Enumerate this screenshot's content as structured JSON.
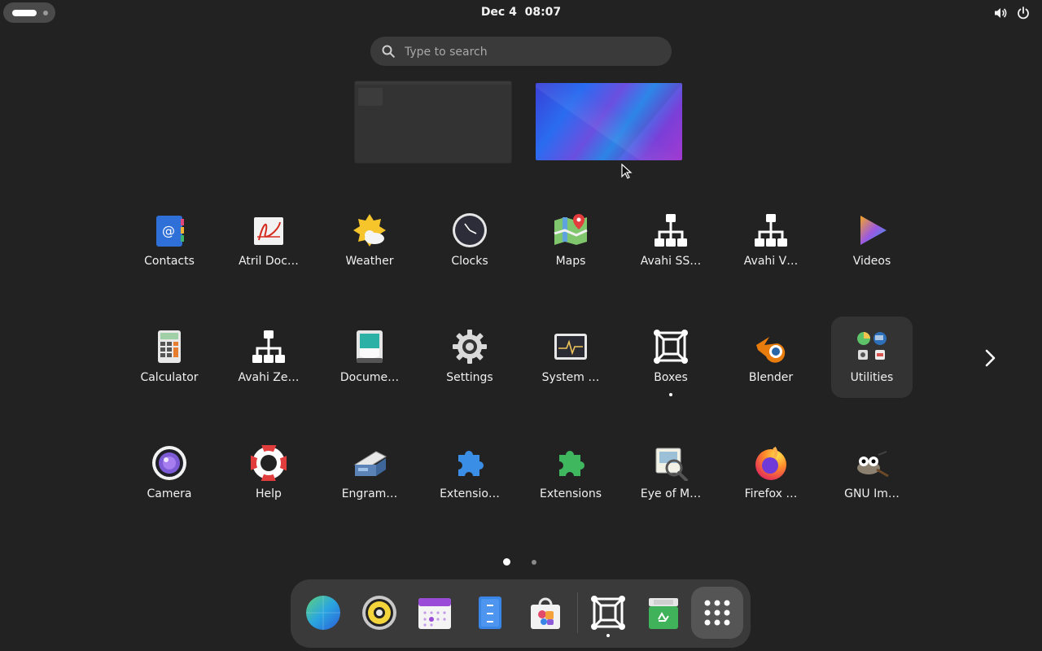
{
  "topbar": {
    "date": "Dec 4",
    "time": "08:07"
  },
  "search": {
    "placeholder": "Type to search"
  },
  "apps": {
    "row1": [
      {
        "label": "Contacts",
        "icon": "contacts-icon"
      },
      {
        "label": "Atril Doc…",
        "icon": "atril-icon"
      },
      {
        "label": "Weather",
        "icon": "weather-icon"
      },
      {
        "label": "Clocks",
        "icon": "clocks-icon"
      },
      {
        "label": "Maps",
        "icon": "maps-icon"
      },
      {
        "label": "Avahi SS…",
        "icon": "network-icon"
      },
      {
        "label": "Avahi V…",
        "icon": "network-icon"
      },
      {
        "label": "Videos",
        "icon": "videos-icon"
      }
    ],
    "row2": [
      {
        "label": "Calculator",
        "icon": "calculator-icon"
      },
      {
        "label": "Avahi Ze…",
        "icon": "network-icon"
      },
      {
        "label": "Docume…",
        "icon": "document-scanner-icon"
      },
      {
        "label": "Settings",
        "icon": "gear-icon"
      },
      {
        "label": "System …",
        "icon": "system-monitor-icon"
      },
      {
        "label": "Boxes",
        "icon": "boxes-icon"
      },
      {
        "label": "Blender",
        "icon": "blender-icon"
      },
      {
        "label": "Utilities",
        "icon": "folder-icon"
      }
    ],
    "row3": [
      {
        "label": "Camera",
        "icon": "camera-icon"
      },
      {
        "label": "Help",
        "icon": "lifebuoy-icon"
      },
      {
        "label": "Engram…",
        "icon": "scanner-icon"
      },
      {
        "label": "Extensio…",
        "icon": "puzzle-icon"
      },
      {
        "label": "Extensions",
        "icon": "puzzle-icon"
      },
      {
        "label": "Eye of M…",
        "icon": "image-viewer-icon"
      },
      {
        "label": "Firefox …",
        "icon": "firefox-icon"
      },
      {
        "label": "GNU Im…",
        "icon": "gimp-icon"
      }
    ]
  },
  "dash": {
    "items": [
      "web-browser-icon",
      "rhythmbox-icon",
      "calendar-icon",
      "files-icon",
      "software-icon",
      "boxes-icon",
      "recycle-icon",
      "app-grid-icon"
    ]
  }
}
